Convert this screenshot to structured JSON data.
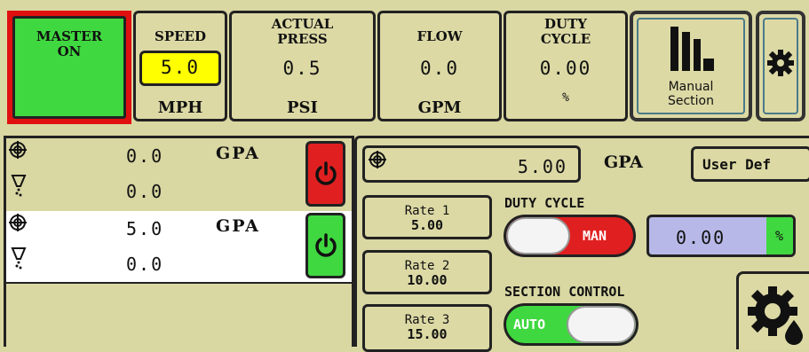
{
  "top": {
    "master": {
      "line1": "MASTER",
      "line2": "ON"
    },
    "speed": {
      "label": "SPEED",
      "value": "5.0",
      "unit": "MPH"
    },
    "actual_press": {
      "line1": "ACTUAL",
      "line2": "PRESS",
      "value": "0.5",
      "unit": "PSI"
    },
    "flow": {
      "label": "FLOW",
      "value": "0.0",
      "unit": "GPM"
    },
    "duty_cycle": {
      "line1": "DUTY",
      "line2": "CYCLE",
      "value": "0.00",
      "unit": "%"
    },
    "manual_section": {
      "line1": "Manual",
      "line2": "Section"
    }
  },
  "products": [
    {
      "rate": "0.0",
      "unit": "GPA",
      "applied": "0.0",
      "power_color": "#e02020",
      "selected": false
    },
    {
      "rate": "5.0",
      "unit": "GPA",
      "applied": "0.0",
      "power_color": "#40d840",
      "selected": true
    }
  ],
  "right": {
    "target_rate": "5.00",
    "target_unit": "GPA",
    "user_def": "User Def",
    "rates": [
      {
        "label": "Rate 1",
        "value": "5.00"
      },
      {
        "label": "Rate 2",
        "value": "10.00"
      },
      {
        "label": "Rate 3",
        "value": "15.00"
      }
    ],
    "duty_cycle_title": "DUTY CYCLE",
    "duty_toggle": "MAN",
    "duty_value": "0.00",
    "duty_unit": "%",
    "section_control_title": "SECTION CONTROL",
    "section_toggle": "AUTO"
  }
}
